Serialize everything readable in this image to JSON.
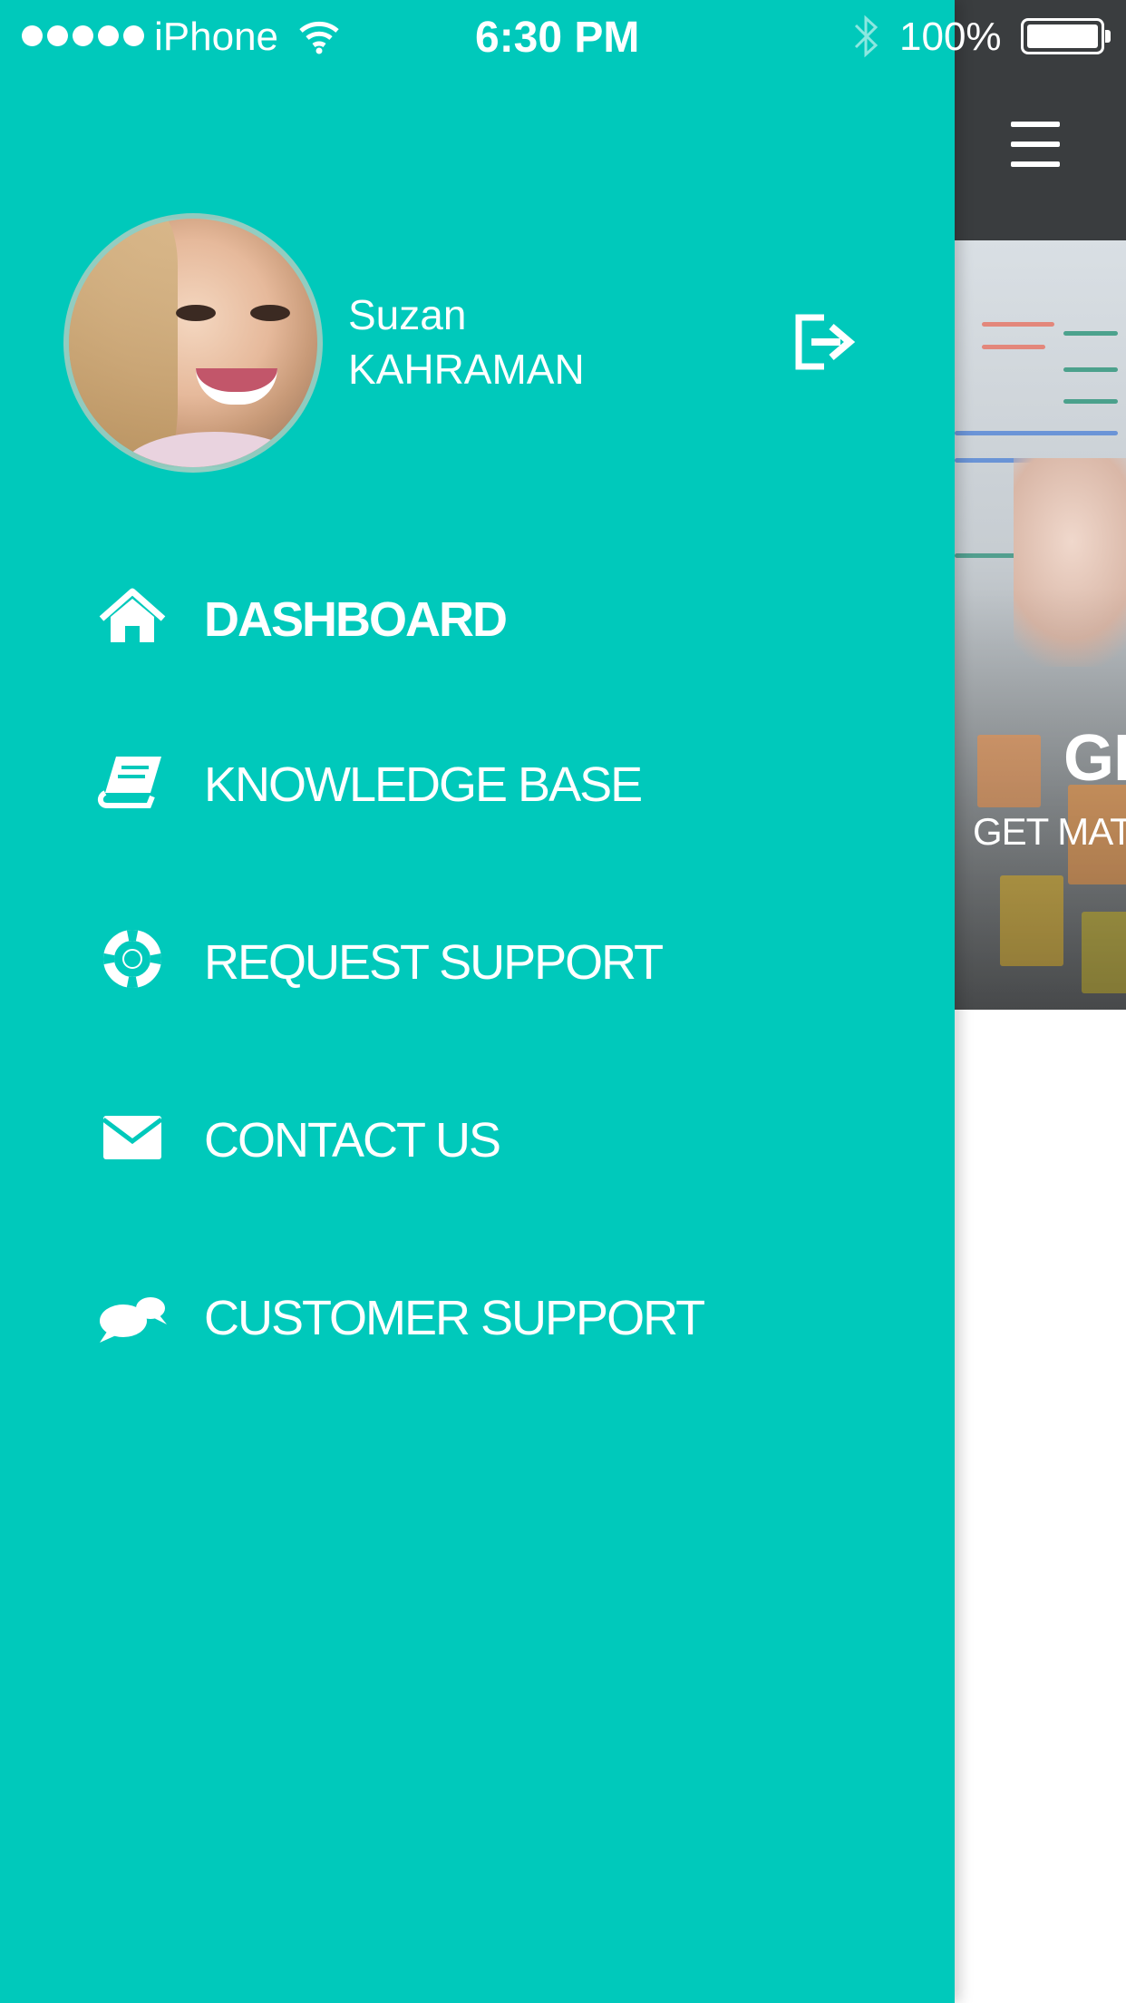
{
  "status_bar": {
    "carrier": "iPhone",
    "time": "6:30 PM",
    "battery": "100%"
  },
  "user": {
    "first_name": "Suzan",
    "last_name": "KAHRAMAN"
  },
  "menu": [
    {
      "label": "DASHBOARD",
      "icon": "home-icon",
      "active": true
    },
    {
      "label": "KNOWLEDGE BASE",
      "icon": "book-icon",
      "active": false
    },
    {
      "label": "REQUEST SUPPORT",
      "icon": "life-ring-icon",
      "active": false
    },
    {
      "label": "CONTACT US",
      "icon": "envelope-icon",
      "active": false
    },
    {
      "label": "CUSTOMER SUPPORT",
      "icon": "chat-bubbles-icon",
      "active": false
    }
  ],
  "hero": {
    "title": "GE",
    "subtitle": "GET MAT"
  },
  "colors": {
    "drawer_bg": "#00c9bb",
    "header_bg": "#3a3d3f",
    "text": "#ffffff"
  }
}
